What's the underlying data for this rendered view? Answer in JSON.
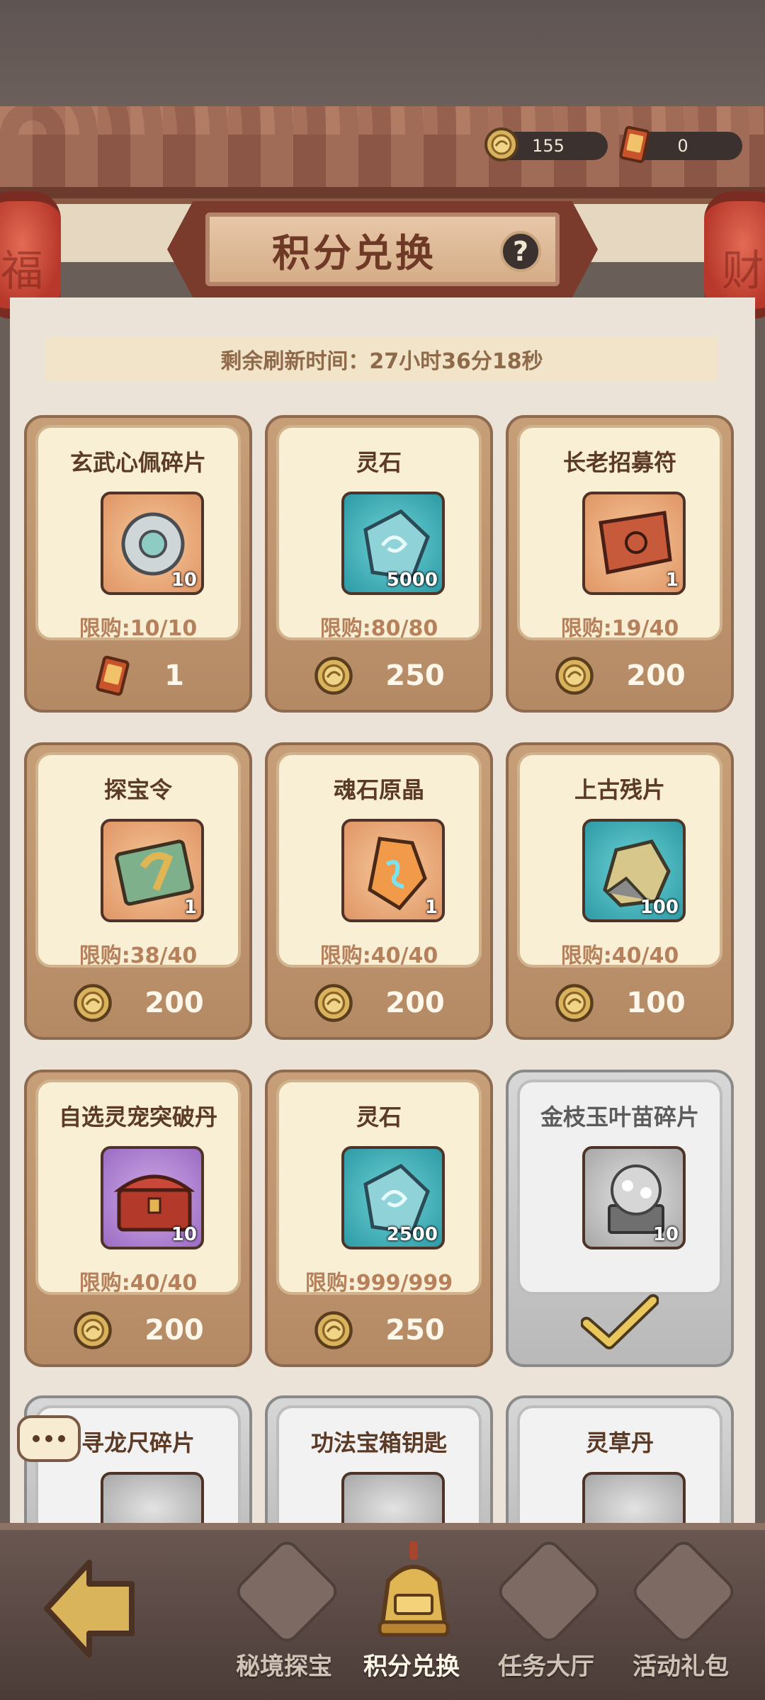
{
  "currency": {
    "coins": "155",
    "tickets": "0"
  },
  "lanterns": {
    "left": "福",
    "right": "财"
  },
  "header": {
    "title": "积分兑换",
    "help_label": "?"
  },
  "refresh": {
    "text": "剩余刷新时间：27小时36分18秒"
  },
  "items": [
    {
      "name": "玄武心佩碎片",
      "qty": "10",
      "limit": "限购:10/10",
      "price": "1",
      "cost_icon": "ticket-icon",
      "box": "orange",
      "art": "jade-pendant-fragment"
    },
    {
      "name": "灵石",
      "qty": "5000",
      "limit": "限购:80/80",
      "price": "250",
      "cost_icon": "coin-icon",
      "box": "teal",
      "art": "spirit-stone"
    },
    {
      "name": "长老招募符",
      "qty": "1",
      "limit": "限购:19/40",
      "price": "200",
      "cost_icon": "coin-icon",
      "box": "orange",
      "art": "recruit-talisman"
    },
    {
      "name": "探宝令",
      "qty": "1",
      "limit": "限购:38/40",
      "price": "200",
      "cost_icon": "coin-icon",
      "box": "orange",
      "art": "treasure-token"
    },
    {
      "name": "魂石原晶",
      "qty": "1",
      "limit": "限购:40/40",
      "price": "200",
      "cost_icon": "coin-icon",
      "box": "orange",
      "art": "soul-crystal"
    },
    {
      "name": "上古残片",
      "qty": "100",
      "limit": "限购:40/40",
      "price": "100",
      "cost_icon": "coin-icon",
      "box": "teal",
      "art": "ancient-fragment"
    },
    {
      "name": "自选灵宠突破丹",
      "qty": "10",
      "limit": "限购:40/40",
      "price": "200",
      "cost_icon": "coin-icon",
      "box": "purple",
      "art": "treasure-chest"
    },
    {
      "name": "灵石",
      "qty": "2500",
      "limit": "限购:999/999",
      "price": "250",
      "cost_icon": "coin-icon",
      "box": "teal",
      "art": "spirit-stone"
    },
    {
      "name": "金枝玉叶苗碎片",
      "qty": "10",
      "limit": "",
      "price": "",
      "cost_icon": "check-icon",
      "box": "grey",
      "art": "sapling-fragment",
      "sold_out": true
    },
    {
      "name": "寻龙尺碎片",
      "qty": "",
      "limit": "",
      "price": "",
      "box": "grey",
      "partial": true
    },
    {
      "name": "功法宝箱钥匙",
      "qty": "",
      "limit": "",
      "price": "",
      "box": "grey",
      "partial": true
    },
    {
      "name": "灵草丹",
      "qty": "",
      "limit": "",
      "price": "",
      "box": "grey",
      "partial": true
    }
  ],
  "nav": {
    "tabs": [
      {
        "label": "秘境探宝",
        "active": false
      },
      {
        "label": "积分兑换",
        "active": true
      },
      {
        "label": "任务大厅",
        "active": false
      },
      {
        "label": "活动礼包",
        "active": false
      }
    ]
  },
  "colors": {
    "card_gold": "#c69f79",
    "card_face": "#f8efd4",
    "banner_red": "#7a3a2c",
    "limit_text": "#b5805b",
    "soldout_grey": "#b9b9b9"
  }
}
